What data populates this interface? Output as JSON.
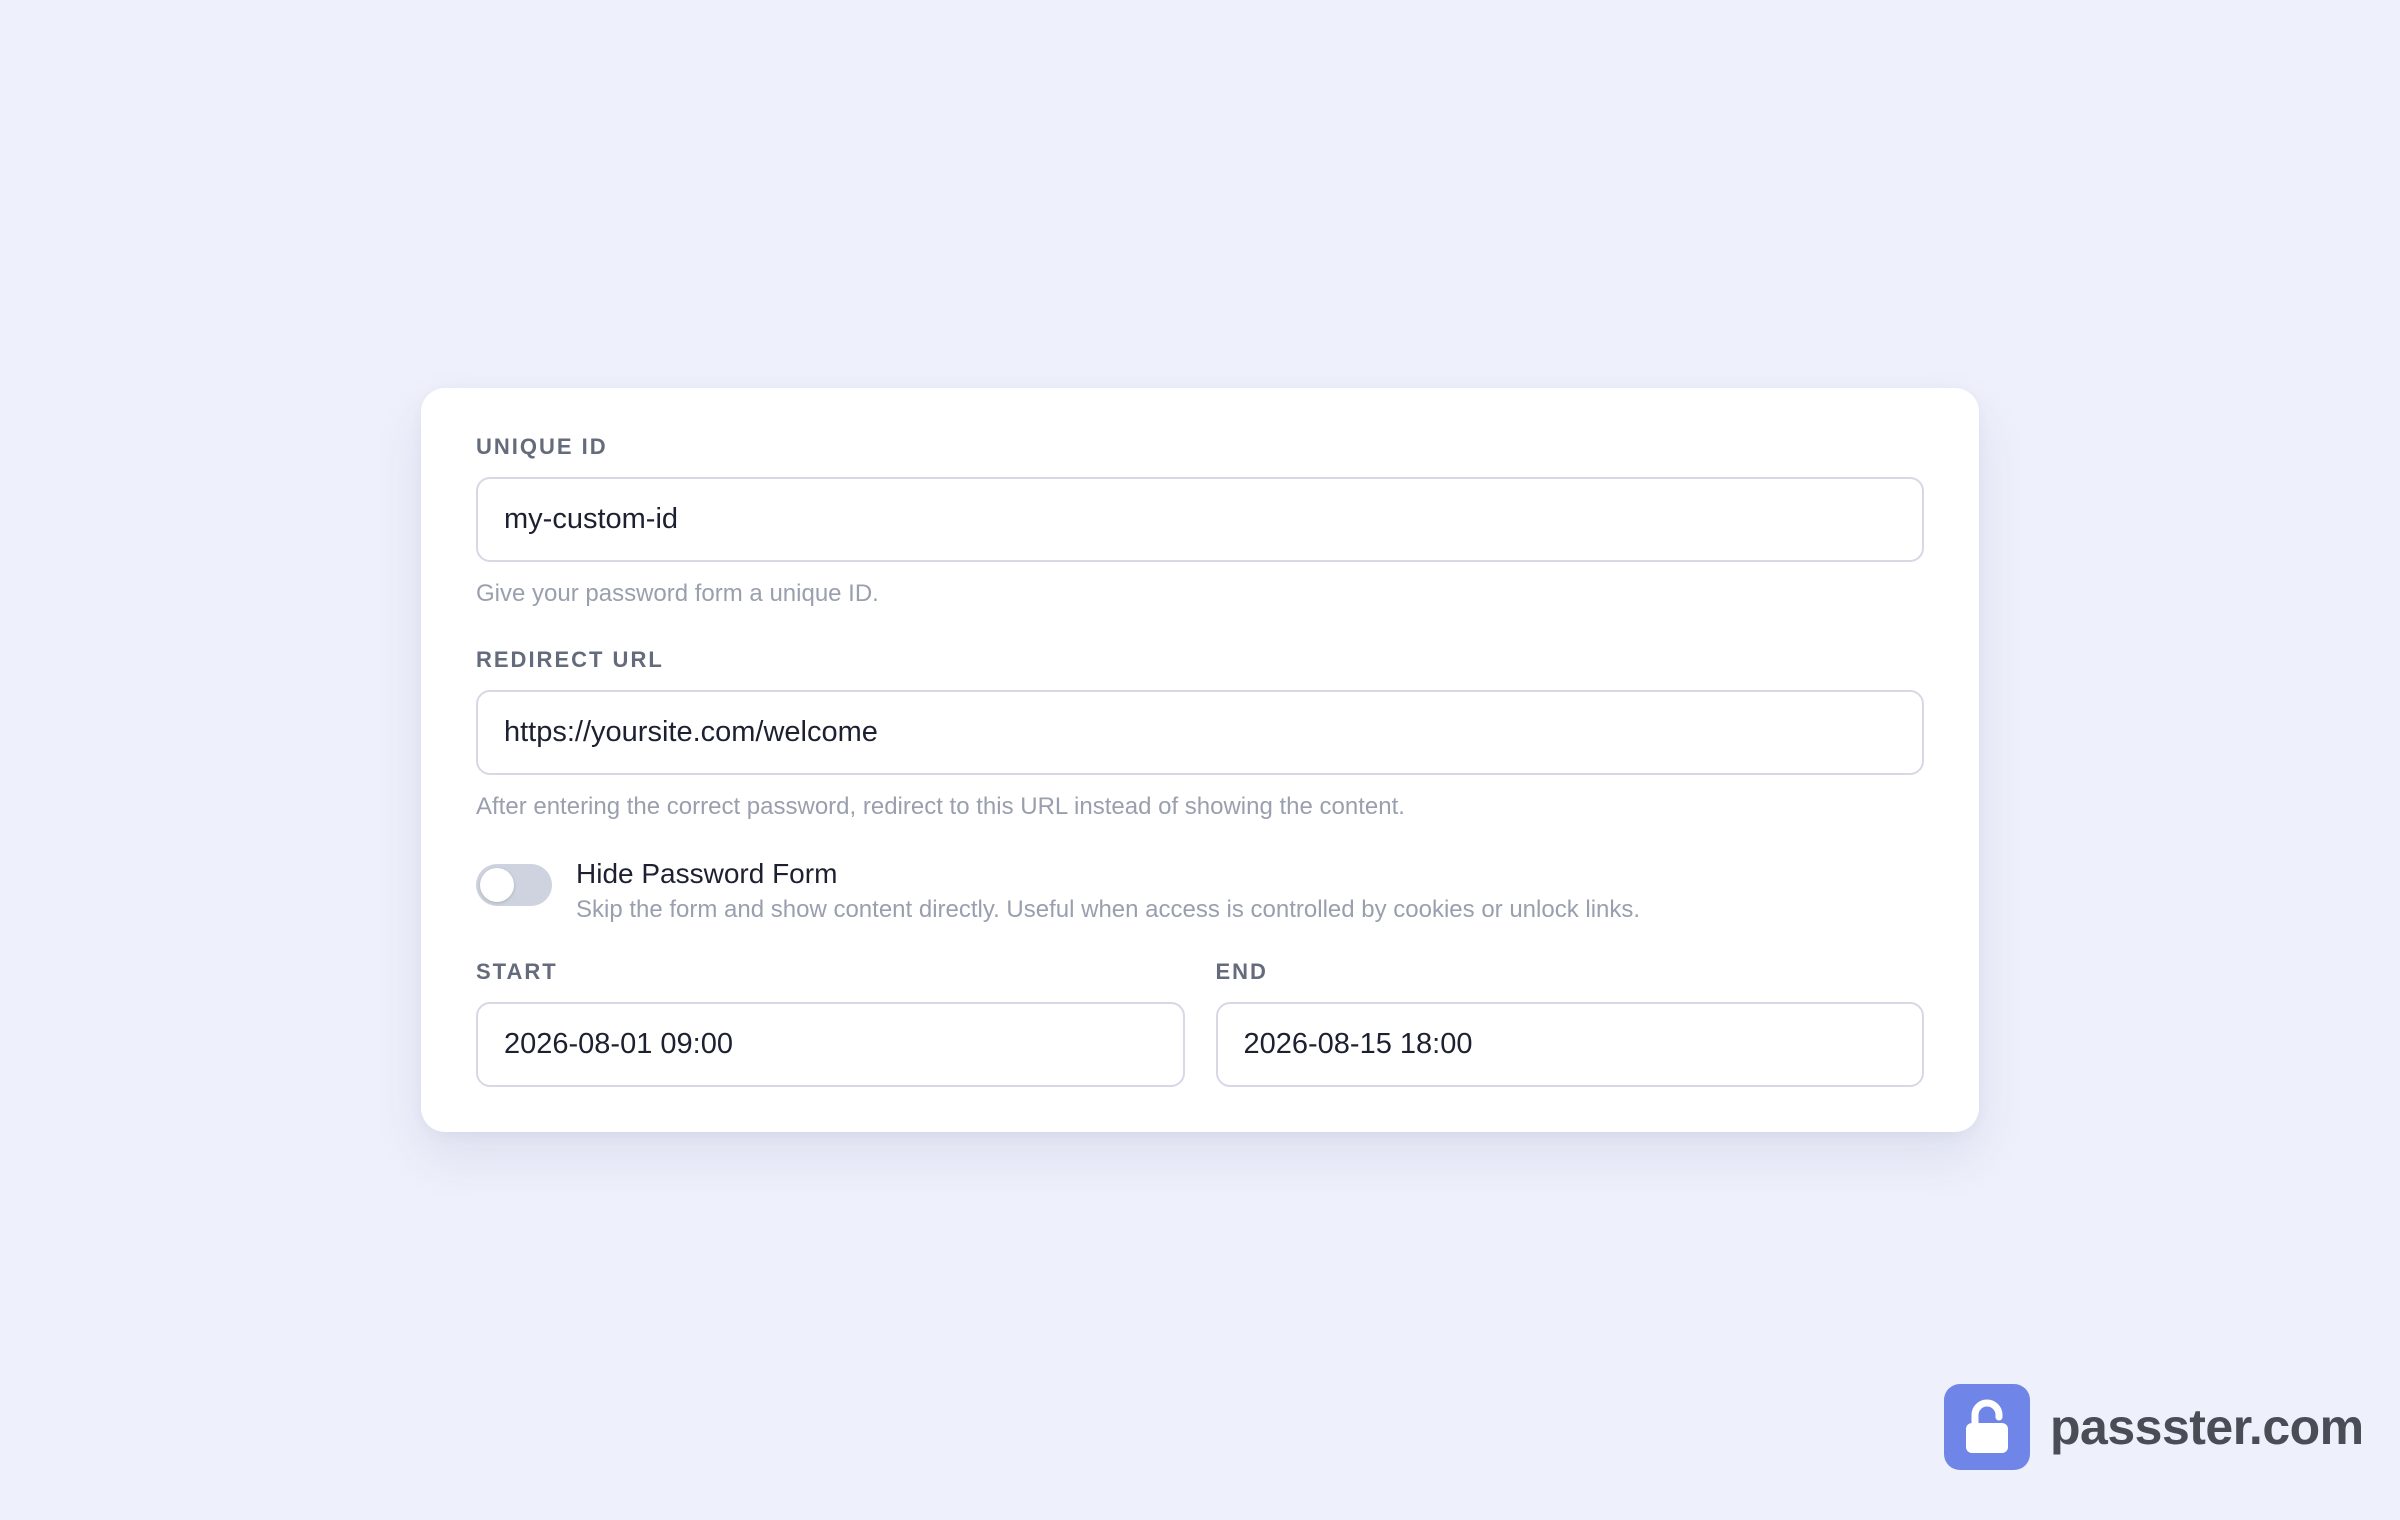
{
  "form": {
    "unique_id": {
      "label": "UNIQUE ID",
      "value": "my-custom-id",
      "help": "Give your password form a unique ID."
    },
    "redirect_url": {
      "label": "REDIRECT URL",
      "value": "https://yoursite.com/welcome",
      "help": "After entering the correct password, redirect to this URL instead of showing the content."
    },
    "hide_form_toggle": {
      "label": "Hide Password Form",
      "description": "Skip the form and show content directly. Useful when access is controlled by cookies or unlock links.",
      "enabled": false
    },
    "start": {
      "label": "START",
      "value": "2026-08-01 09:00"
    },
    "end": {
      "label": "END",
      "value": "2026-08-15 18:00"
    }
  },
  "brand": {
    "text": "passster.com",
    "icon": "lock-icon",
    "color": "#6f86e8"
  },
  "colors": {
    "background": "#eef0fb",
    "card": "#ffffff",
    "toggle_off": "#cfd3df"
  }
}
